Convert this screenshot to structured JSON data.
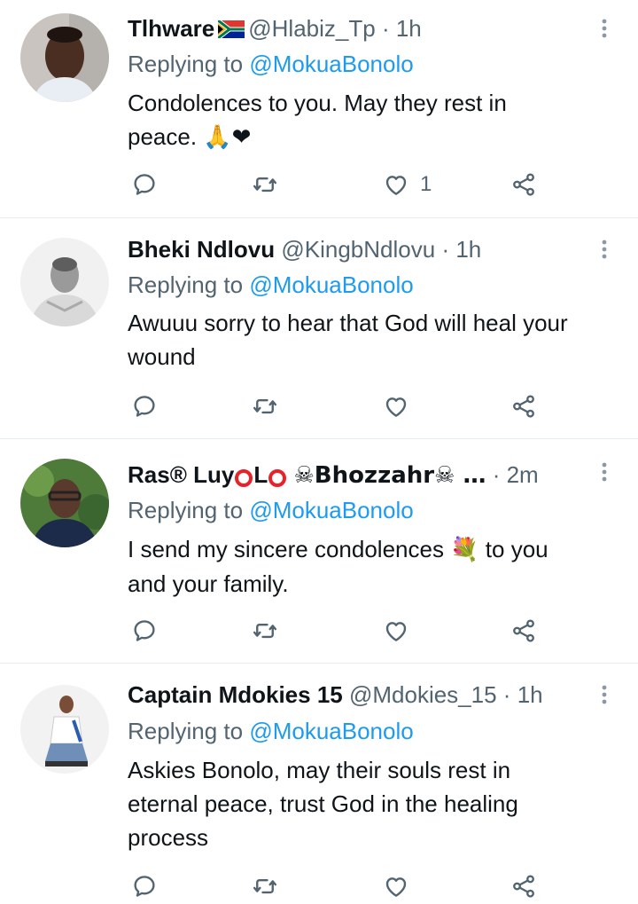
{
  "tweets": [
    {
      "name": "Tlhware",
      "flag": "south-africa-flag",
      "handle": "@Hlabiz_Tp",
      "sep": "·",
      "time": "1h",
      "replying_prefix": "Replying to",
      "replying_to": "@MokuaBonolo",
      "text_lines": [
        "Condolences to you. May they rest in",
        "peace. 🙏❤"
      ],
      "like_count": "1"
    },
    {
      "name": "Bheki Ndlovu",
      "handle": "@KingbNdlovu",
      "sep": "·",
      "time": "1h",
      "replying_prefix": "Replying to",
      "replying_to": "@MokuaBonolo",
      "text_lines": [
        "Awuuu sorry to hear that God will heal your",
        "wound"
      ],
      "like_count": ""
    },
    {
      "name_part1": "Ras® Luy",
      "name_part2": "L",
      "name_part3": "☠Bhozzahr☠ …",
      "sep": "·",
      "time": "2m",
      "replying_prefix": "Replying to",
      "replying_to": "@MokuaBonolo",
      "text_line1_a": "I send my sincere condolences ",
      "text_line1_emoji": "💐",
      "text_line1_b": " to you",
      "text_line2": "and your family.",
      "like_count": ""
    },
    {
      "name": "Captain Mdokies 15",
      "handle": "@Mdokies_15",
      "sep": "·",
      "time": "1h",
      "replying_prefix": "Replying to",
      "replying_to": "@MokuaBonolo",
      "text_lines": [
        "Askies Bonolo, may their souls rest in",
        "eternal peace, trust God in the healing",
        "process"
      ],
      "like_count": ""
    }
  ],
  "icons": {
    "reply": "reply-icon",
    "retweet": "retweet-icon",
    "like": "heart-icon",
    "share": "share-icon",
    "more": "more-options-icon"
  },
  "colors": {
    "text": "#0f1419",
    "secondary": "#536471",
    "link": "#1d9bf0",
    "divider": "#e6ecf0"
  }
}
